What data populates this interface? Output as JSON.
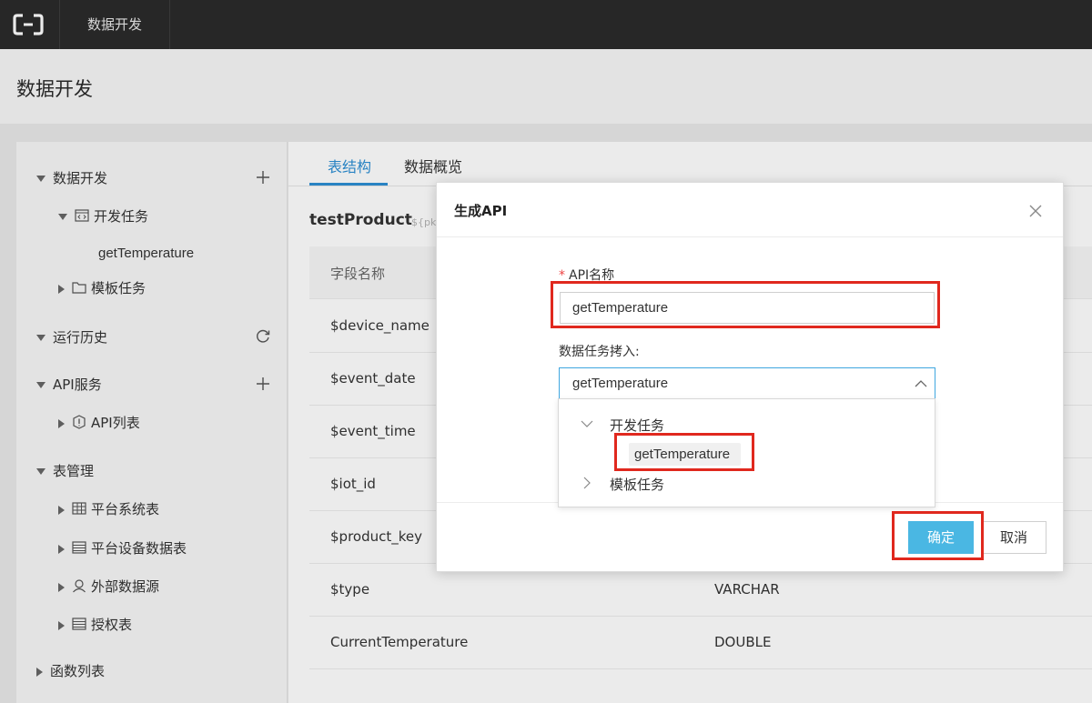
{
  "topbar": {
    "app_tab": "数据开发",
    "logo_icon": "aliyun-logo-icon"
  },
  "page": {
    "title": "数据开发"
  },
  "sidebar": {
    "items": [
      {
        "label": "数据开发",
        "state": "expanded",
        "action_icon": "plus-icon"
      },
      {
        "label": "开发任务",
        "state": "expanded",
        "icon": "code-file-icon"
      },
      {
        "label": "getTemperature"
      },
      {
        "label": "模板任务",
        "state": "collapsed",
        "icon": "folder-icon"
      },
      {
        "label": "运行历史",
        "state": "expanded",
        "action_icon": "refresh-icon"
      },
      {
        "label": "API服务",
        "state": "expanded",
        "action_icon": "plus-icon"
      },
      {
        "label": "API列表",
        "state": "collapsed",
        "icon": "api-icon"
      },
      {
        "label": "表管理",
        "state": "expanded"
      },
      {
        "label": "平台系统表",
        "state": "collapsed",
        "icon": "table-icon"
      },
      {
        "label": "平台设备数据表",
        "state": "collapsed",
        "icon": "table-list-icon"
      },
      {
        "label": "外部数据源",
        "state": "collapsed",
        "icon": "user-icon"
      },
      {
        "label": "授权表",
        "state": "collapsed",
        "icon": "table-list-icon"
      },
      {
        "label": "函数列表",
        "state": "collapsed"
      }
    ]
  },
  "main": {
    "tabs": [
      {
        "label": "表结构",
        "active": true
      },
      {
        "label": "数据概览",
        "active": false
      }
    ],
    "table_name": "testProduct",
    "table_sub": "${pk",
    "columns": {
      "name": "字段名称"
    },
    "rows": [
      {
        "name": "$device_name",
        "type": ""
      },
      {
        "name": "$event_date",
        "type": ""
      },
      {
        "name": "$event_time",
        "type": ""
      },
      {
        "name": "$iot_id",
        "type": ""
      },
      {
        "name": "$product_key",
        "type": ""
      },
      {
        "name": "$type",
        "type": "VARCHAR"
      },
      {
        "name": "CurrentTemperature",
        "type": "DOUBLE"
      }
    ]
  },
  "modal": {
    "title": "生成API",
    "api_name_label": "API名称",
    "required_mark": "*",
    "api_name_value": "getTemperature",
    "task_label": "数据任务拷入:",
    "task_selected": "getTemperature",
    "dropdown": {
      "group1": "开发任务",
      "group1_item": "getTemperature",
      "group2": "模板任务"
    },
    "ok_label": "确定",
    "cancel_label": "取消"
  },
  "colors": {
    "accent": "#2d8fd4",
    "primary_button": "#4ab7e3",
    "highlight": "#e0281e",
    "topbar": "#2b2b2b"
  }
}
